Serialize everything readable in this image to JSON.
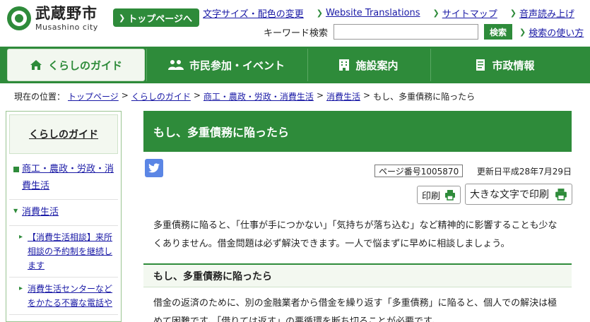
{
  "header": {
    "logo_jp": "武蔵野市",
    "logo_en": "Musashino city",
    "top_button": "トップページへ",
    "utility_links": [
      "文字サイズ・配色の変更",
      "Website Translations",
      "サイトマップ",
      "音声読み上げ"
    ],
    "search_label": "キーワード検索",
    "search_placeholder": "",
    "search_button": "検索",
    "search_help": "検索の使い方"
  },
  "nav": [
    {
      "label": "くらしのガイド",
      "icon": "house-icon",
      "active": true
    },
    {
      "label": "市民参加・イベント",
      "icon": "people-icon",
      "active": false
    },
    {
      "label": "施設案内",
      "icon": "building-icon",
      "active": false
    },
    {
      "label": "市政情報",
      "icon": "document-icon",
      "active": false
    }
  ],
  "breadcrumb": {
    "prefix": "現在の位置：",
    "links": [
      "トップページ",
      "くらしのガイド",
      "商工・農政・労政・消費生活",
      "消費生活"
    ],
    "current": "もし、多重債務に陥ったら",
    "separator": ">"
  },
  "sidebar": {
    "heading": "くらしのガイド",
    "items": [
      {
        "label": "商工・農政・労政・消費生活"
      },
      {
        "label": "消費生活"
      },
      {
        "label": "【消費生活相談】来所相談の予約制を継続します"
      },
      {
        "label": "消費生活センターなどをかたる不審な電話や"
      }
    ]
  },
  "main": {
    "title": "もし、多重債務に陥ったら",
    "page_number": "ページ番号1005870",
    "updated": "更新日平成28年7月29日",
    "print_label": "印刷",
    "print_large_label": "大きな文字で印刷",
    "intro": "多重債務に陥ると、「仕事が手につかない」「気持ちが落ち込む」など精神的に影響することも少なくありません。借金問題は必ず解決できます。一人で悩まずに早めに相談しましょう。",
    "section_heading": "もし、多重債務に陥ったら",
    "body": "借金の返済のために、別の金融業者から借金を繰り返す「多重債務」に陥ると、個人での解決は極めて困難です。「借りては返す」の悪循環を断ち切ることが必要です。"
  },
  "colors": {
    "brand": "#2e8b3a",
    "link": "#1a1aa6",
    "twitter": "#5b86e5"
  }
}
